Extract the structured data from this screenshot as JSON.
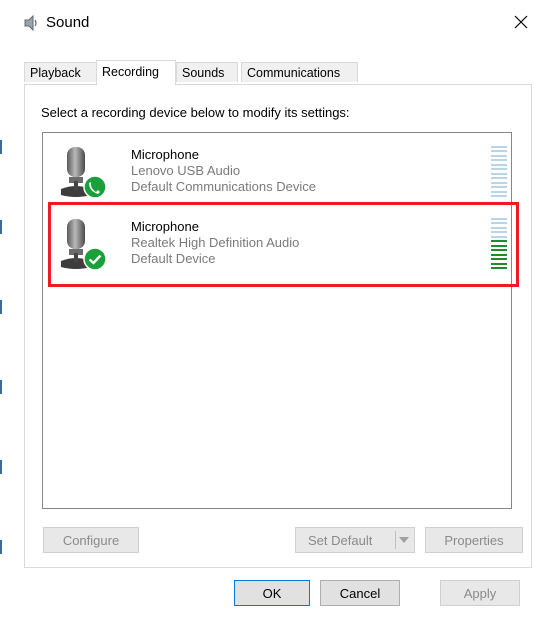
{
  "window": {
    "title": "Sound",
    "icon": "speaker-icon",
    "close_icon": "close-icon"
  },
  "tabs": [
    {
      "label": "Playback",
      "active": false
    },
    {
      "label": "Recording",
      "active": true
    },
    {
      "label": "Sounds",
      "active": false
    },
    {
      "label": "Communications",
      "active": false
    }
  ],
  "instruction": "Select a recording device below to modify its settings:",
  "devices": [
    {
      "name": "Microphone",
      "line2": "Lenovo USB Audio",
      "line3": "Default Communications Device",
      "badge": "phone-icon",
      "level_segments_on": 0,
      "selected": false
    },
    {
      "name": "Microphone",
      "line2": "Realtek High Definition Audio",
      "line3": "Default Device",
      "badge": "check-icon",
      "level_segments_on": 7,
      "selected": true
    }
  ],
  "buttons": {
    "configure": "Configure",
    "set_default": "Set Default",
    "properties": "Properties",
    "ok": "OK",
    "cancel": "Cancel",
    "apply": "Apply"
  },
  "colors": {
    "highlight": "#ee1b24",
    "badge_green": "#1aa03a",
    "meter_off": "#b9d4e5",
    "meter_on": "#1e8c2e"
  }
}
